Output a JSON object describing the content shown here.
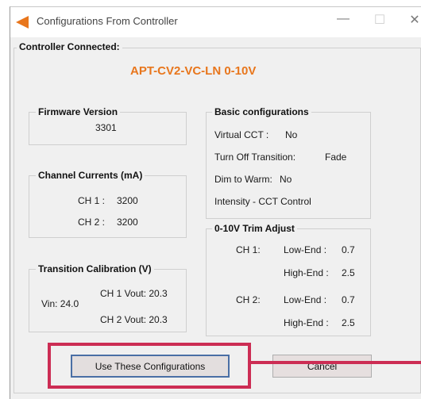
{
  "window": {
    "title": "Configurations From Controller",
    "controls": {
      "minimize": "—",
      "maximize": "☐",
      "close": "✕"
    }
  },
  "main": {
    "group_label": "Controller Connected:",
    "model": "APT-CV2-VC-LN 0-10V"
  },
  "firmware": {
    "label": "Firmware Version",
    "value": "3301"
  },
  "channel_currents": {
    "label": "Channel Currents (mA)",
    "rows": [
      {
        "name": "CH 1 :",
        "value": "3200"
      },
      {
        "name": "CH 2 :",
        "value": "3200"
      }
    ]
  },
  "transition_calibration": {
    "label": "Transition Calibration (V)",
    "vin": "Vin: 24.0",
    "ch1": "CH 1 Vout: 20.3",
    "ch2": "CH 2 Vout: 20.3"
  },
  "basic_configurations": {
    "label": "Basic configurations",
    "virtual_cct_label": "Virtual CCT :",
    "virtual_cct_value": "No",
    "turn_off_label": "Turn Off Transition:",
    "turn_off_value": "Fade",
    "dim_to_warm_label": "Dim to Warm:",
    "dim_to_warm_value": "No",
    "intensity": "Intensity - CCT Control"
  },
  "trim_adjust": {
    "label": "0-10V Trim Adjust",
    "ch1": {
      "name": "CH 1:",
      "low_label": "Low-End :",
      "low_value": "0.7",
      "high_label": "High-End :",
      "high_value": "2.5"
    },
    "ch2": {
      "name": "CH 2:",
      "low_label": "Low-End :",
      "low_value": "0.7",
      "high_label": "High-End :",
      "high_value": "2.5"
    }
  },
  "buttons": {
    "use": "Use These Configurations",
    "cancel": "Cancel"
  },
  "colors": {
    "accent_orange": "#e8761c",
    "highlight_red": "#cc2d54",
    "window_bg": "#f0f0f0"
  },
  "icons": {
    "app": "orange-triangle-icon"
  }
}
